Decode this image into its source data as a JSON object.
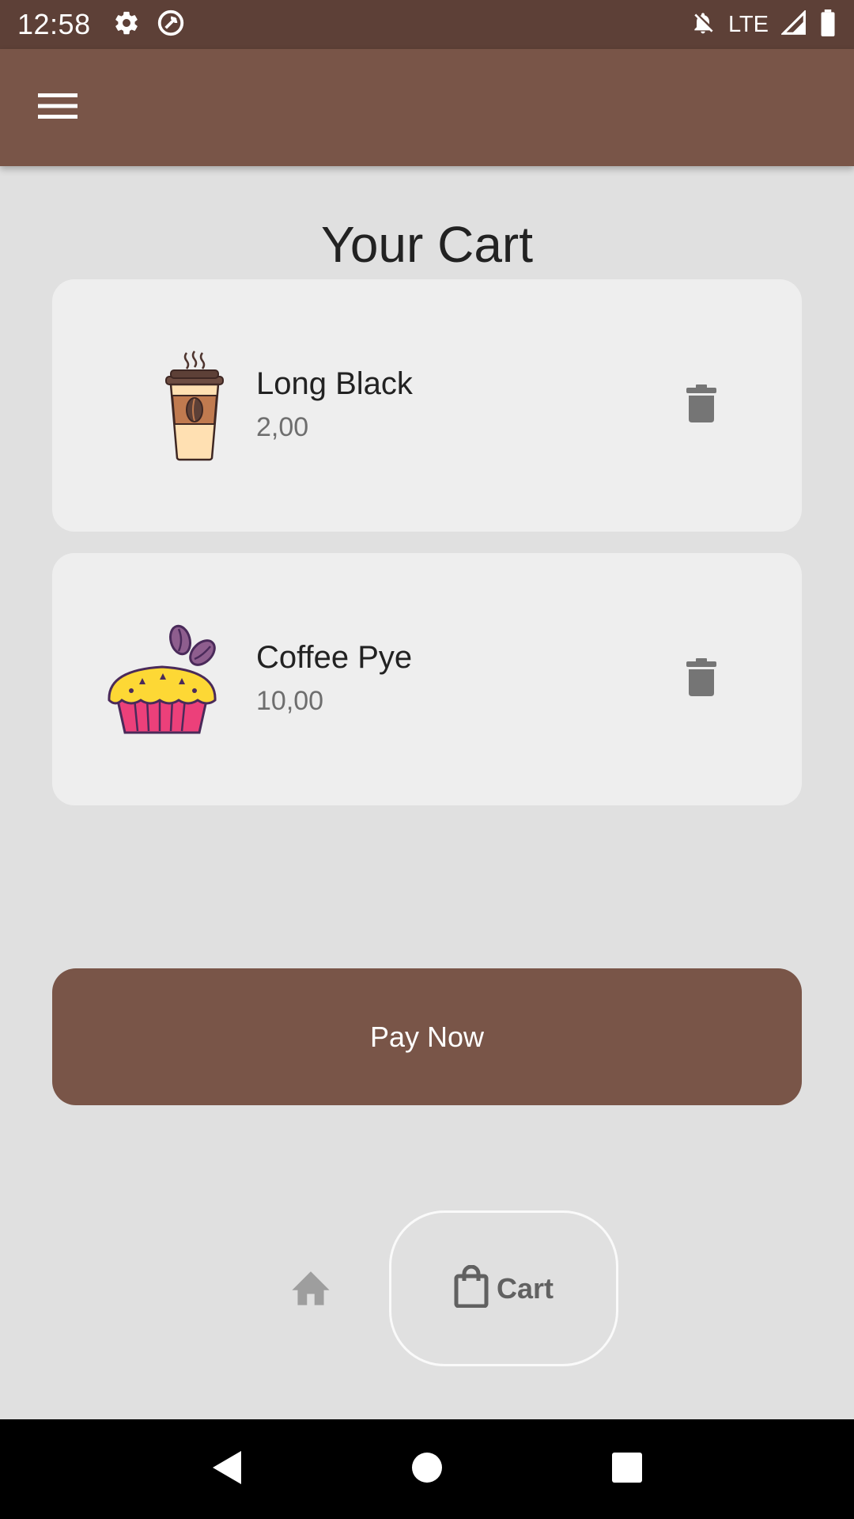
{
  "status_bar": {
    "time": "12:58",
    "network": "LTE",
    "icons": [
      "gear-icon",
      "data-saver-icon",
      "notifications-off-icon",
      "signal-icon",
      "battery-icon"
    ]
  },
  "app_bar": {
    "menu_icon": "menu-icon",
    "background": "#795548"
  },
  "page": {
    "title": "Your Cart"
  },
  "cart": {
    "items": [
      {
        "name": "Long Black",
        "price": "2,00",
        "image": "coffee-cup-icon"
      },
      {
        "name": "Coffee Pye",
        "price": "10,00",
        "image": "coffee-pie-icon"
      }
    ],
    "delete_icon": "trash-icon"
  },
  "pay_button": {
    "label": "Pay Now"
  },
  "bottom_nav": {
    "home_icon": "home-icon",
    "cart_label": "Cart",
    "cart_icon": "shopping-bag-icon"
  },
  "colors": {
    "primary": "#795548",
    "primary_dark": "#5d4037",
    "background": "#e0e0e0",
    "card": "#eeeeee"
  }
}
